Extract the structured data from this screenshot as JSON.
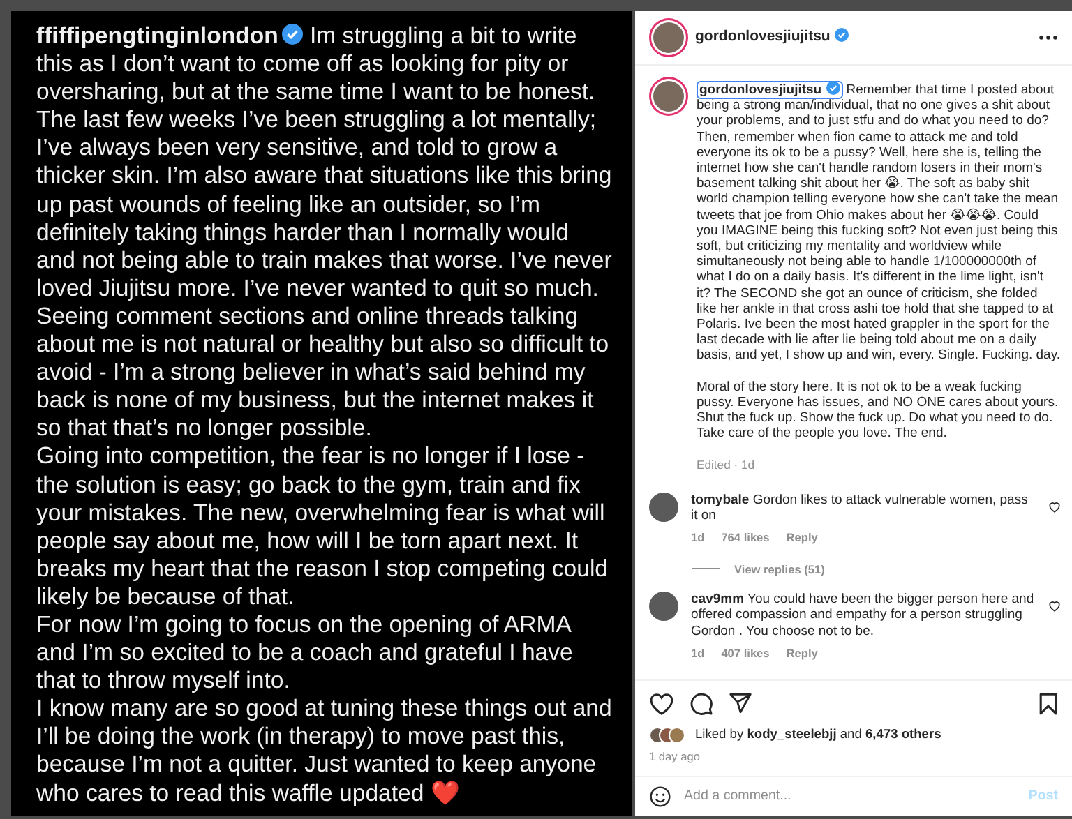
{
  "story": {
    "username": "ffiffipengtinginlondon",
    "verified": true,
    "paragraphs": [
      "Im struggling a bit to write this as I don’t want to come off as looking for pity or oversharing, but at the same time I want to be honest. The last few weeks I’ve been struggling a lot mentally; I’ve always been very sensitive, and told to grow a thicker skin. I’m also aware that situations like this bring up past wounds of feeling like an outsider, so I’m definitely taking things harder than I normally would and not being able to train makes that worse. I’ve never loved Jiujitsu more. I’ve never wanted to quit so much. Seeing comment sections and online threads talking about me is not natural or healthy but also so difficult to avoid - I’m a strong believer in what’s said behind my back is none of my business, but the internet makes it so that that’s no longer possible.",
      "Going into competition, the fear is no longer if I lose - the solution is easy; go back to the gym, train and fix your mistakes. The new, overwhelming fear is what will people say about me, how will I be torn apart next. It breaks my heart that the reason I stop competing could likely be because of that.",
      "For now I’m going to focus on the opening of ARMA and I’m so excited to be a coach and grateful I have that to throw myself into.",
      "I know many are so good at tuning these things out and I’ll be doing the work (in therapy) to move past this, because I’m not a quitter. Just wanted to keep anyone who cares to read this waffle updated ❤️"
    ]
  },
  "post": {
    "header": {
      "username": "gordonlovesjiujitsu",
      "verified": true
    },
    "caption": {
      "username": "gordonlovesjiujitsu",
      "verified": true,
      "paragraphs": [
        "Remember that time I posted about being a strong man/individual, that no one gives a shit about your problems, and to just stfu and do what you need to do? Then, remember when fion came to attack me and told everyone its ok to be a pussy? Well, here she is, telling the internet how she can't handle random losers in their mom's basement talking shit about her 😭. The soft as baby shit world champion telling everyone how she can't take the mean tweets that joe from Ohio makes about her 😭😭😭. Could you IMAGINE being this fucking soft? Not even just being this soft, but criticizing my mentality and worldview while simultaneously not being able to handle 1/100000000th of what I do on a daily basis. It's different in the lime light, isn't it? The SECOND she got an ounce of criticism, she folded like her ankle in that cross ashi toe hold that she tapped to at Polaris. Ive been the most hated grappler in the sport for the last decade with lie after lie being told about me on a daily basis, and yet, I show up and win, every. Single. Fucking. day.",
        "Moral of the story here. It is not ok to be a weak fucking pussy. Everyone has issues, and NO ONE cares about yours. Shut the fuck up. Show the fuck up. Do what you need to do. Take care of the people you love. The end."
      ],
      "meta": "Edited · 1d"
    },
    "comments": [
      {
        "username": "tomybale",
        "text": "Gordon likes to attack vulnerable women, pass it on",
        "time": "1d",
        "likes": "764 likes",
        "reply": "Reply",
        "view_replies": "View replies (51)"
      },
      {
        "username": "cav9mm",
        "text": "You could have been the bigger person here and offered compassion and empathy for a person struggling Gordon . You choose not to be.",
        "time": "1d",
        "likes": "407 likes",
        "reply": "Reply"
      }
    ],
    "liked_by": "Liked by **kody_steelebjj** and **6,473 others**",
    "time": "1 day ago",
    "add_comment": {
      "placeholder": "Add a comment...",
      "button": "Post",
      "button_enabled": false
    }
  }
}
